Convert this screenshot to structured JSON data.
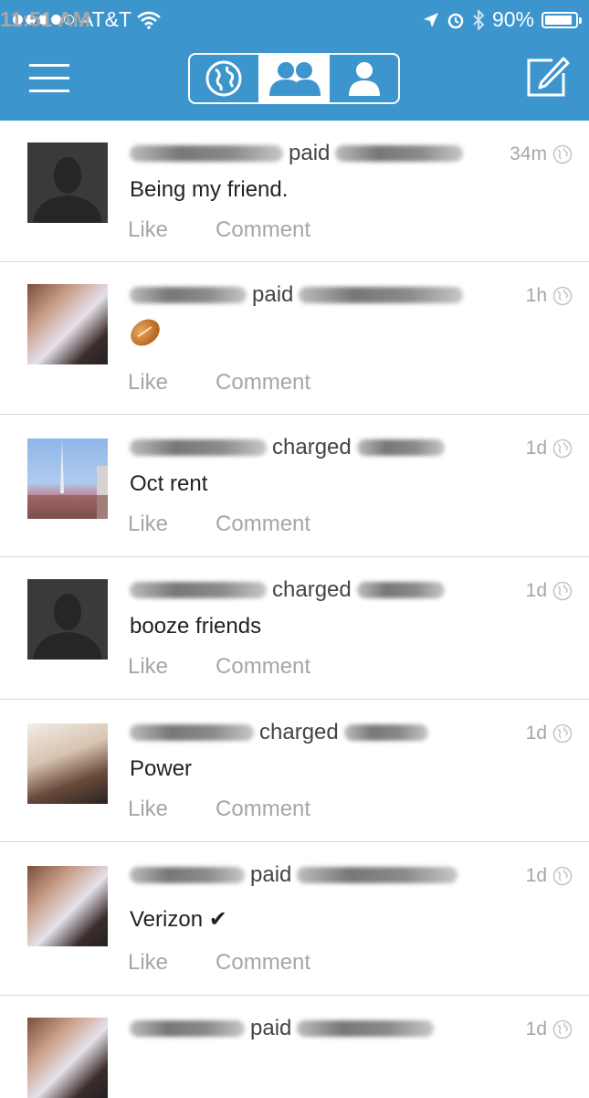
{
  "status_bar": {
    "carrier": "AT&T",
    "time": "11:51 AM",
    "battery": "90%",
    "battery_level": 0.9,
    "icons": [
      "signal-dots-icon",
      "wifi-icon",
      "location-arrow-icon",
      "alarm-icon",
      "bluetooth-icon",
      "battery-icon"
    ]
  },
  "navbar": {
    "icons": [
      "menu-icon",
      "globe-icon",
      "friends-icon",
      "person-icon",
      "compose-icon"
    ],
    "active_tab": "friends"
  },
  "feed": {
    "items": [
      {
        "verb": "paid",
        "time": "34m",
        "message": "Being my friend.",
        "like": "Like",
        "comment": "Comment"
      },
      {
        "verb": "paid",
        "time": "1h",
        "message": "",
        "message_icon": "football-emoji",
        "like": "Like",
        "comment": "Comment"
      },
      {
        "verb": "charged",
        "time": "1d",
        "message": "Oct rent",
        "like": "Like",
        "comment": "Comment"
      },
      {
        "verb": "charged",
        "time": "1d",
        "message": "booze friends",
        "like": "Like",
        "comment": "Comment"
      },
      {
        "verb": "charged",
        "time": "1d",
        "message": "Power",
        "like": "Like",
        "comment": "Comment"
      },
      {
        "verb": "paid",
        "time": "1d",
        "message": "Verizon ✔",
        "like": "Like",
        "comment": "Comment"
      },
      {
        "verb": "paid",
        "time": "1d"
      }
    ]
  },
  "colors": {
    "brand_blue": "#3d95ce",
    "muted_text": "#a6a6a6",
    "divider": "#d6d6d6"
  }
}
